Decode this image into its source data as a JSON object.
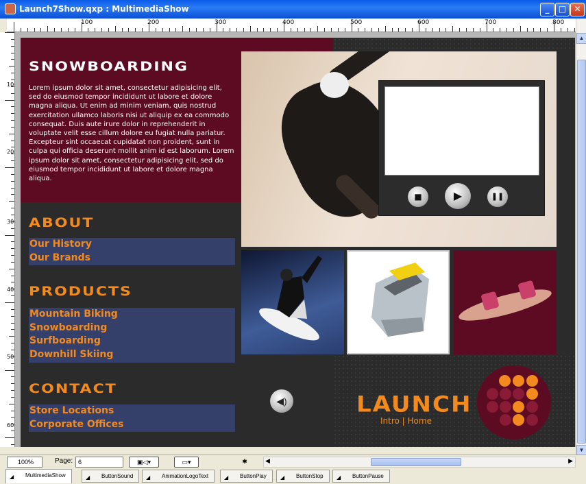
{
  "window": {
    "title": "Launch7Show.qxp : MultimediaShow",
    "minimize_icon": "minimize-icon",
    "maximize_icon": "maximize-icon",
    "close_icon": "close-icon"
  },
  "ruler": {
    "h_labels": [
      "100",
      "200",
      "300",
      "400",
      "500",
      "600",
      "700",
      "800"
    ],
    "v_labels": [
      "100",
      "200",
      "300",
      "400",
      "500",
      "600"
    ]
  },
  "layout": {
    "snowboarding": {
      "heading": "SNOWBOARDING",
      "body": "Lorem ipsum dolor sit amet, consectetur adipisicing elit, sed do eiusmod tempor incididunt ut labore et dolore magna aliqua. Ut enim ad minim veniam, quis nostrud exercitation ullamco laboris nisi ut aliquip ex ea commodo consequat. Duis aute irure dolor in reprehenderit in voluptate velit esse cillum dolore eu fugiat nulla pariatur. Excepteur sint occaecat cupidatat non proident, sunt in culpa qui officia deserunt mollit anim id est laborum. Lorem ipsum dolor sit amet, consectetur adipisicing elit, sed do eiusmod tempor incididunt ut labore et dolore magna aliqua."
    },
    "about": {
      "heading": "ABOUT",
      "links": [
        "Our History",
        "Our Brands"
      ]
    },
    "products": {
      "heading": "PRODUCTS",
      "links": [
        "Mountain Biking",
        "Snowboarding",
        "Surfboarding",
        "Downhill Skiing"
      ]
    },
    "contact": {
      "heading": "CONTACT",
      "links": [
        "Store Locations",
        "Corporate Offices"
      ]
    },
    "logo": {
      "text": "LAUNCH",
      "links": "Intro | Home",
      "brand_color": "#f28a1e",
      "dark_red": "#5c0b22"
    },
    "player": {
      "stop_icon": "stop-icon",
      "play_icon": "play-icon",
      "pause_icon": "pause-icon"
    },
    "sound_icon": "speaker-icon"
  },
  "statusbar": {
    "zoom": "100%",
    "page_label": "Page:",
    "page_value": "6"
  },
  "tabs": [
    "MultimediaShow",
    "ButtonSound",
    "AnimationLogoText",
    "ButtonPlay",
    "ButtonStop",
    "ButtonPause"
  ]
}
